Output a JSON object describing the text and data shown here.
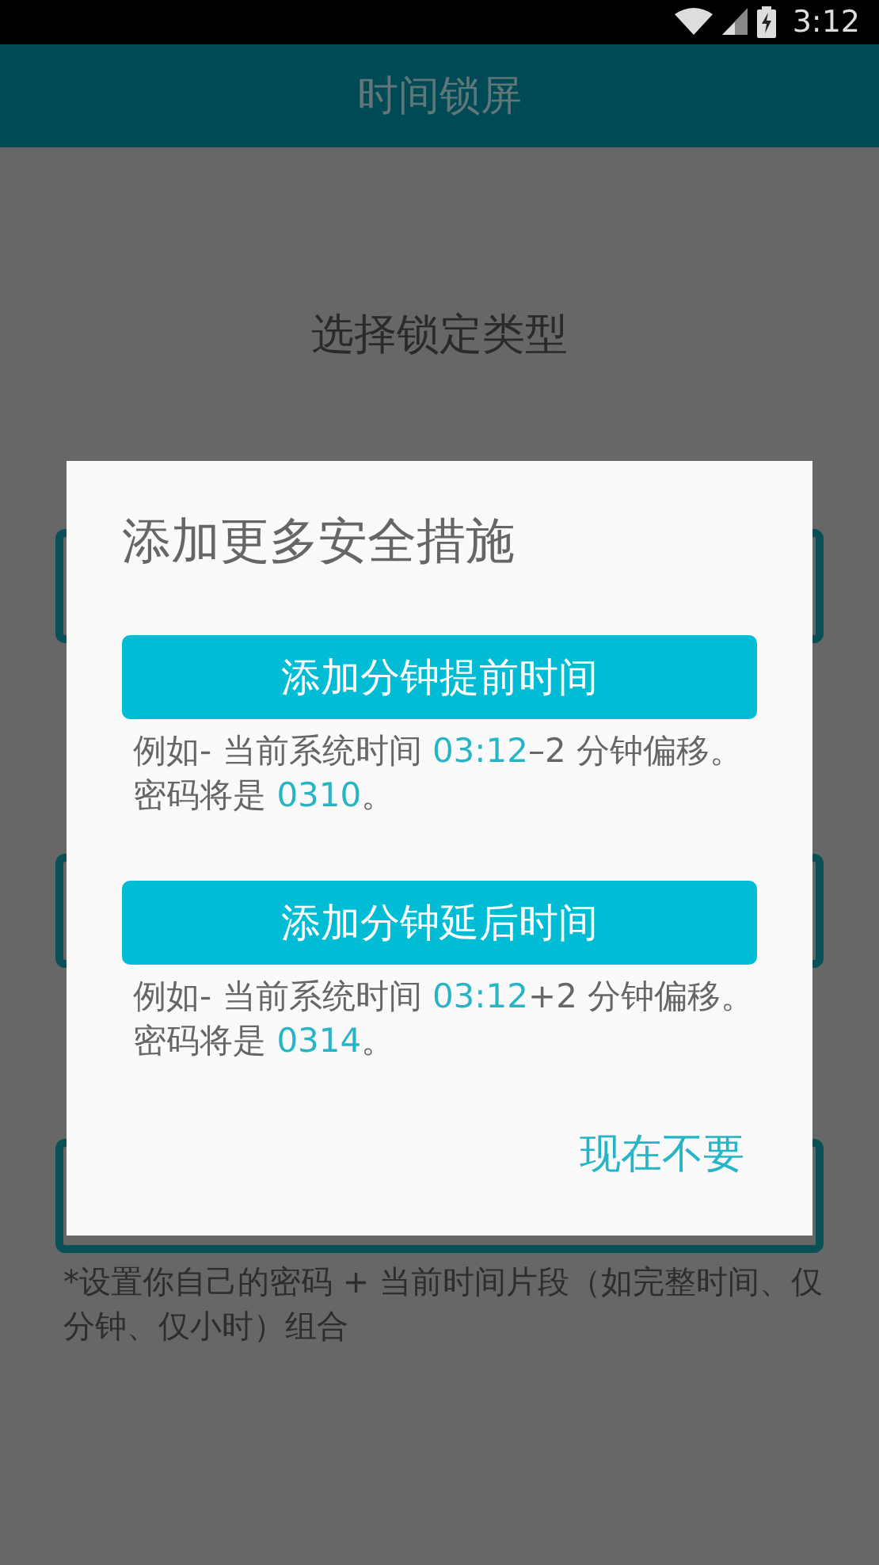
{
  "status_bar": {
    "time": "3:12"
  },
  "app_bar": {
    "title": "时间锁屏"
  },
  "page": {
    "heading": "选择锁定类型",
    "note": "*设置你自己的密码 + 当前时间片段（如完整时间、仅分钟、仅小时）组合"
  },
  "dialog": {
    "title": "添加更多安全措施",
    "options": [
      {
        "button": "添加分钟提前时间",
        "description": [
          {
            "kind": "plain",
            "text": "例如- 当前系统时间 "
          },
          {
            "kind": "highlight",
            "text": "03:12"
          },
          {
            "kind": "plain",
            "text": "–2 分钟偏移。密码将是 "
          },
          {
            "kind": "highlight",
            "text": "0310"
          },
          {
            "kind": "plain",
            "text": "。"
          }
        ]
      },
      {
        "button": "添加分钟延后时间",
        "description": [
          {
            "kind": "plain",
            "text": "例如- 当前系统时间 "
          },
          {
            "kind": "highlight",
            "text": "03:12"
          },
          {
            "kind": "plain",
            "text": "+2 分钟偏移。密码将是 "
          },
          {
            "kind": "highlight",
            "text": "0314"
          },
          {
            "kind": "plain",
            "text": "。"
          }
        ]
      }
    ],
    "dismiss": "现在不要"
  }
}
